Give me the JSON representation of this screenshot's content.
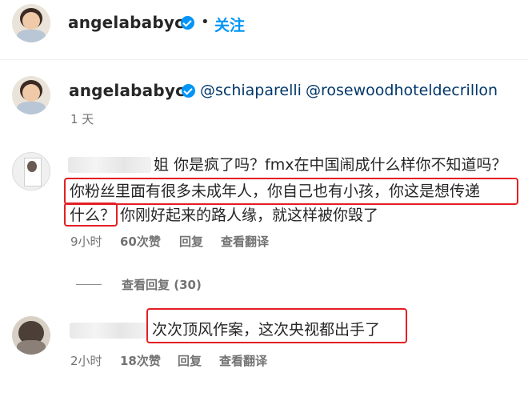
{
  "post_header": {
    "username": "angelababyct",
    "separator": "•",
    "follow_label": "关注"
  },
  "caption": {
    "username": "angelababyct",
    "mentions": [
      "@schiaparelli",
      "@rosewoodhoteldecrillon"
    ],
    "time": "1 天"
  },
  "comments": [
    {
      "lines": [
        "姐 你是疯了吗？fmx在中国闹成什么样你不知道吗？",
        "你粉丝里面有很多未成年人，你自己也有小孩，你这是想传递",
        "什么？",
        "你刚好起来的路人缘，就这样被你毁了"
      ],
      "time": "9小时",
      "likes": "60次赞",
      "reply_label": "回复",
      "translate_label": "查看翻译",
      "view_replies": "查看回复 (30)"
    },
    {
      "lines": [
        "次次顶风作案，这次央视都出手了"
      ],
      "time": "2小时",
      "likes": "18次赞",
      "reply_label": "回复",
      "translate_label": "查看翻译"
    }
  ],
  "colors": {
    "accent_blue": "#0095f6",
    "mention_blue": "#00376b",
    "highlight_red": "#e31e24",
    "meta_gray": "#737373"
  },
  "icons": [
    "verified-badge-icon"
  ]
}
